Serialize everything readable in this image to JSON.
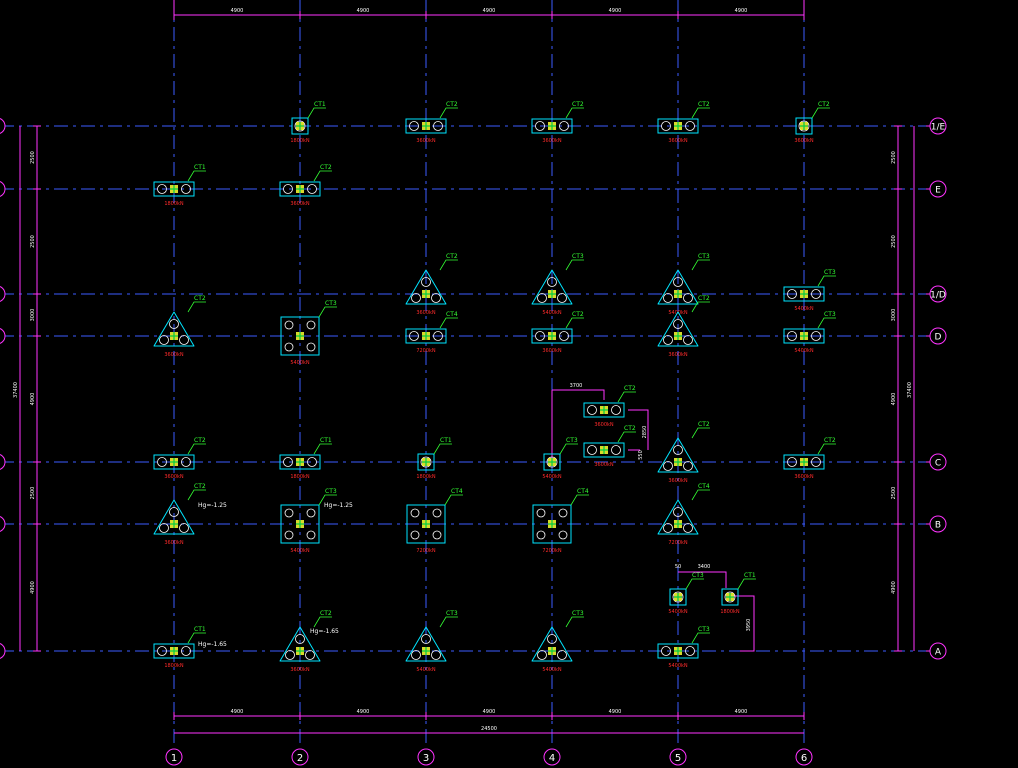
{
  "drawing": {
    "colors": {
      "background": "#000000",
      "grid_line": "#3b5bff",
      "dimension": "#ff33ff",
      "pile_cap": "#00e5ff",
      "pile": "#ffffff",
      "label_green": "#33ff33",
      "capacity_red": "#ff2b2b",
      "column": "#ffff33"
    },
    "axes_x": [
      "1",
      "2",
      "3",
      "4",
      "5",
      "6"
    ],
    "axes_y": [
      "1/E",
      "E",
      "1/D",
      "D",
      "C",
      "B",
      "A"
    ],
    "top_dimensions": [
      "4900",
      "4900",
      "4900",
      "4900",
      "4900"
    ],
    "bottom_dimensions": [
      "4900",
      "4900",
      "4900",
      "4900",
      "4900"
    ],
    "bottom_total": "24500",
    "left_dimensions": [
      "2500",
      "2500",
      "3000",
      "4900",
      "2500",
      "4900"
    ],
    "left_total": "37400",
    "right_dimensions": [
      "2500",
      "2500",
      "3000",
      "4900",
      "2500",
      "4900"
    ],
    "right_total": "37400",
    "aux_dimensions": [
      "3700",
      "2850",
      "550",
      "3400",
      "50",
      "3950"
    ],
    "elevation_notes": [
      "Hg=-1.25",
      "Hg=-1.25",
      "Hg=-1.65",
      "Hg=-1.65"
    ],
    "pile_caps": [
      {
        "type": "single",
        "label": "CT1",
        "capacity": "1800kN"
      },
      {
        "type": "double",
        "label": "CT2",
        "capacity": "3600kN"
      },
      {
        "type": "double",
        "label": "CT2",
        "capacity": "3600kN"
      },
      {
        "type": "double",
        "label": "CT2",
        "capacity": "3600kN"
      },
      {
        "type": "double",
        "label": "CT2",
        "capacity": "3600kN"
      },
      {
        "type": "single",
        "label": "CT1",
        "capacity": "1800kN"
      },
      {
        "type": "double",
        "label": "CT2",
        "capacity": "3600kN"
      },
      {
        "type": "double",
        "label": "CT2",
        "capacity": "3600kN"
      },
      {
        "type": "triple",
        "label": "CT3",
        "capacity": "5400kN"
      },
      {
        "type": "triple",
        "label": "CT3",
        "capacity": "5400kN"
      },
      {
        "type": "triple",
        "label": "CT3",
        "capacity": "5400kN"
      },
      {
        "type": "double",
        "label": "CT2",
        "capacity": "3600kN"
      },
      {
        "type": "triple",
        "label": "CT3",
        "capacity": "5400kN"
      },
      {
        "type": "quad",
        "label": "CT4",
        "capacity": "7200kN"
      },
      {
        "type": "double",
        "label": "CT2",
        "capacity": "3600kN"
      },
      {
        "type": "double",
        "label": "CT2",
        "capacity": "3600kN"
      },
      {
        "type": "triple",
        "label": "CT3",
        "capacity": "5400kN"
      },
      {
        "type": "double",
        "label": "CT2",
        "capacity": "3600kN"
      },
      {
        "type": "double",
        "label": "CT2",
        "capacity": "3600kN"
      },
      {
        "type": "double",
        "label": "CT2",
        "capacity": "3600kN"
      },
      {
        "type": "single",
        "label": "CT1",
        "capacity": "1800kN"
      },
      {
        "type": "single",
        "label": "CT1",
        "capacity": "1800kN"
      },
      {
        "type": "triple",
        "label": "CT3",
        "capacity": "5400kN"
      },
      {
        "type": "double",
        "label": "CT2",
        "capacity": "3600kN"
      },
      {
        "type": "double",
        "label": "CT2",
        "capacity": "3600kN"
      },
      {
        "type": "double",
        "label": "CT2",
        "capacity": "3600kN"
      },
      {
        "type": "triple",
        "label": "CT3",
        "capacity": "5400kN"
      },
      {
        "type": "quad",
        "label": "CT4",
        "capacity": "7200kN"
      },
      {
        "type": "quad",
        "label": "CT4",
        "capacity": "7200kN"
      },
      {
        "type": "quad",
        "label": "CT4",
        "capacity": "7200kN"
      },
      {
        "type": "triple",
        "label": "CT3",
        "capacity": "5400kN"
      },
      {
        "type": "single",
        "label": "CT1",
        "capacity": "1800kN"
      },
      {
        "type": "single",
        "label": "CT1",
        "capacity": "1800kN"
      },
      {
        "type": "double",
        "label": "CT2",
        "capacity": "3600kN"
      },
      {
        "type": "triple",
        "label": "CT3",
        "capacity": "5400kN"
      },
      {
        "type": "triple",
        "label": "CT3",
        "capacity": "5400kN"
      },
      {
        "type": "triple",
        "label": "CT3",
        "capacity": "5400kN"
      },
      {
        "type": "double",
        "label": "CT2",
        "capacity": "3600kN"
      }
    ]
  }
}
